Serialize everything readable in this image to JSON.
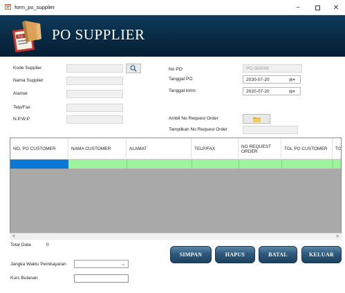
{
  "window": {
    "title": "form_po_supplier",
    "minimize": "−",
    "close": "✕"
  },
  "banner": {
    "title": "PO SUPPLIER",
    "logo_icon": "po-document-logo"
  },
  "form_left": {
    "kode_supplier": {
      "label": "Kode Supplier",
      "value": ""
    },
    "nama_supplier": {
      "label": "Nama Supplier",
      "value": ""
    },
    "alamat": {
      "label": "Alamat",
      "value": ""
    },
    "telp_fax": {
      "label": "Telp/Fax",
      "value": ""
    },
    "npwp": {
      "label": "N.P.W.P",
      "value": ""
    }
  },
  "form_right": {
    "no_po": {
      "label": "No PO",
      "value": "PO 000008"
    },
    "tanggal_po": {
      "label": "Tanggal PO",
      "value": "2020-07-20"
    },
    "tanggal_kirim": {
      "label": "Tanggal kirim",
      "value": "2020-07-20"
    },
    "ambil_request": {
      "label": "Ambil No Request Order"
    },
    "tampilkan_request": {
      "label": "Tampilkan No Request Order",
      "value": ""
    }
  },
  "table": {
    "columns": [
      "NO. PO CUSTOMER",
      "NAMA CUSTOMER",
      "ALAMAT",
      "TELP/FAX",
      "NO REQUEST ORDER",
      "TGL PO CUSTOMER",
      "TGL CUSTO"
    ],
    "scroll_left": "<",
    "scroll_right": ">"
  },
  "footer": {
    "total_label": "Total Data",
    "total_value": "0",
    "jangka_label": "Jangka Waktu Pembayaran",
    "jangka_value": "",
    "kurs_label": "Kurs Bulanan",
    "kurs_value": ""
  },
  "buttons": {
    "simpan": "SIMPAN",
    "hapus": "HAPUS",
    "batal": "BATAL",
    "keluar": "KELUAR"
  },
  "colors": {
    "banner": "#0f3a5a",
    "row_highlight": "#9cf49c",
    "row_selection": "#0a78d7",
    "grid_background": "#a9a9a9",
    "button": "#2d5a7c"
  }
}
